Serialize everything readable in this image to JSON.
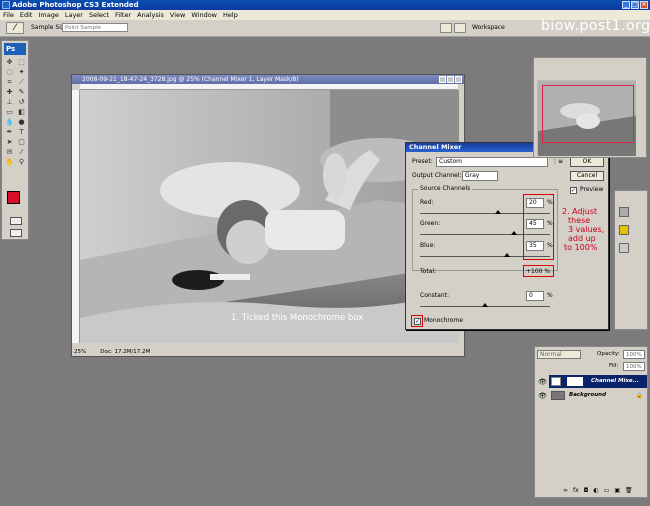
{
  "app": {
    "title": "Adobe Photoshop CS3 Extended",
    "logo_text": "Ps"
  },
  "menu": [
    "File",
    "Edit",
    "Image",
    "Layer",
    "Select",
    "Filter",
    "Analysis",
    "View",
    "Window",
    "Help"
  ],
  "options": {
    "sample_size_label": "Sample Size:",
    "sample_size_value": "Point Sample",
    "workspace_label": "Workspace"
  },
  "watermark": "biow.post1.org",
  "document": {
    "title": "2008-09-21_18-47-24_3728.jpg @ 25% (Channel Mixer 1, Layer Mask/8)",
    "zoom": "25%",
    "doc_size": "Doc: 17.2M/17.2M"
  },
  "mixer": {
    "title": "Channel Mixer",
    "preset_label": "Preset:",
    "preset_value": "Custom",
    "output_label": "Output Channel:",
    "output_value": "Gray",
    "source_group": "Source Channels",
    "red_label": "Red:",
    "red_value": "20",
    "green_label": "Green:",
    "green_value": "45",
    "blue_label": "Blue:",
    "blue_value": "35",
    "pct": "%",
    "total_label": "Total:",
    "total_value": "+100 %",
    "constant_label": "Constant:",
    "constant_value": "0",
    "monochrome_label": "Monochrome",
    "ok": "OK",
    "cancel": "Cancel",
    "preview_label": "Preview",
    "slider_levels": {
      "red": 0.6,
      "green": 0.72,
      "blue": 0.67,
      "constant": 0.5
    }
  },
  "annotations": {
    "tick": "1. Ticked this Monochrome box",
    "adjust": [
      "2. Adjust",
      "these",
      "3 values,",
      "add up",
      "to 100%"
    ]
  },
  "layers": {
    "blend_mode": "Normal",
    "opacity_label": "Opacity:",
    "opacity_value": "100%",
    "fill_label": "Fill:",
    "fill_value": "100%",
    "items": [
      "Channel Mixe...",
      "Background"
    ]
  },
  "colors": {
    "foreground": "#d8102a",
    "accent_red": "#c8001e",
    "selection": "#0a246a"
  }
}
